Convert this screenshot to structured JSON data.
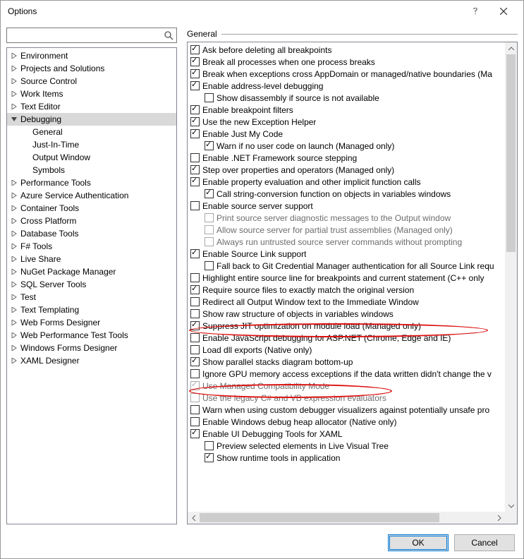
{
  "window": {
    "title": "Options"
  },
  "search": {
    "placeholder": ""
  },
  "section": {
    "label": "General"
  },
  "tree": [
    {
      "label": "Environment",
      "expandable": true
    },
    {
      "label": "Projects and Solutions",
      "expandable": true
    },
    {
      "label": "Source Control",
      "expandable": true
    },
    {
      "label": "Work Items",
      "expandable": true
    },
    {
      "label": "Text Editor",
      "expandable": true
    },
    {
      "label": "Debugging",
      "expandable": true,
      "expanded": true,
      "selected": true,
      "children": [
        {
          "label": "General"
        },
        {
          "label": "Just-In-Time"
        },
        {
          "label": "Output Window"
        },
        {
          "label": "Symbols"
        }
      ]
    },
    {
      "label": "Performance Tools",
      "expandable": true
    },
    {
      "label": "Azure Service Authentication",
      "expandable": true
    },
    {
      "label": "Container Tools",
      "expandable": true
    },
    {
      "label": "Cross Platform",
      "expandable": true
    },
    {
      "label": "Database Tools",
      "expandable": true
    },
    {
      "label": "F# Tools",
      "expandable": true
    },
    {
      "label": "Live Share",
      "expandable": true
    },
    {
      "label": "NuGet Package Manager",
      "expandable": true
    },
    {
      "label": "SQL Server Tools",
      "expandable": true
    },
    {
      "label": "Test",
      "expandable": true
    },
    {
      "label": "Text Templating",
      "expandable": true
    },
    {
      "label": "Web Forms Designer",
      "expandable": true
    },
    {
      "label": "Web Performance Test Tools",
      "expandable": true
    },
    {
      "label": "Windows Forms Designer",
      "expandable": true
    },
    {
      "label": "XAML Designer",
      "expandable": true
    }
  ],
  "options": [
    {
      "indent": 1,
      "checked": true,
      "label": "Ask before deleting all breakpoints"
    },
    {
      "indent": 1,
      "checked": true,
      "label": "Break all processes when one process breaks"
    },
    {
      "indent": 1,
      "checked": true,
      "label": "Break when exceptions cross AppDomain or managed/native boundaries (Ma"
    },
    {
      "indent": 1,
      "checked": true,
      "label": "Enable address-level debugging"
    },
    {
      "indent": 2,
      "checked": false,
      "label": "Show disassembly if source is not available"
    },
    {
      "indent": 1,
      "checked": true,
      "label": "Enable breakpoint filters"
    },
    {
      "indent": 1,
      "checked": true,
      "label": "Use the new Exception Helper"
    },
    {
      "indent": 1,
      "checked": true,
      "label": "Enable Just My Code"
    },
    {
      "indent": 2,
      "checked": true,
      "label": "Warn if no user code on launch (Managed only)"
    },
    {
      "indent": 1,
      "checked": false,
      "label": "Enable .NET Framework source stepping"
    },
    {
      "indent": 1,
      "checked": true,
      "label": "Step over properties and operators (Managed only)"
    },
    {
      "indent": 1,
      "checked": true,
      "label": "Enable property evaluation and other implicit function calls"
    },
    {
      "indent": 2,
      "checked": true,
      "label": "Call string-conversion function on objects in variables windows"
    },
    {
      "indent": 1,
      "checked": false,
      "label": "Enable source server support"
    },
    {
      "indent": 2,
      "checked": false,
      "disabled": true,
      "label": "Print source server diagnostic messages to the Output window"
    },
    {
      "indent": 2,
      "checked": false,
      "disabled": true,
      "label": "Allow source server for partial trust assemblies (Managed only)"
    },
    {
      "indent": 2,
      "checked": false,
      "disabled": true,
      "label": "Always run untrusted source server commands without prompting"
    },
    {
      "indent": 1,
      "checked": true,
      "label": "Enable Source Link support"
    },
    {
      "indent": 2,
      "checked": false,
      "label": "Fall back to Git Credential Manager authentication for all Source Link requ"
    },
    {
      "indent": 1,
      "checked": false,
      "label": "Highlight entire source line for breakpoints and current statement (C++ only"
    },
    {
      "indent": 1,
      "checked": true,
      "label": "Require source files to exactly match the original version"
    },
    {
      "indent": 1,
      "checked": false,
      "label": "Redirect all Output Window text to the Immediate Window"
    },
    {
      "indent": 1,
      "checked": false,
      "label": "Show raw structure of objects in variables windows"
    },
    {
      "indent": 1,
      "checked": true,
      "label": "Suppress JIT optimization on module load (Managed only)"
    },
    {
      "indent": 1,
      "checked": false,
      "label": "Enable JavaScript debugging for ASP.NET (Chrome, Edge and IE)"
    },
    {
      "indent": 1,
      "checked": false,
      "label": "Load dll exports (Native only)"
    },
    {
      "indent": 1,
      "checked": true,
      "label": "Show parallel stacks diagram bottom-up"
    },
    {
      "indent": 1,
      "checked": false,
      "label": "Ignore GPU memory access exceptions if the data written didn't change the v"
    },
    {
      "indent": 1,
      "checked": true,
      "disabled": true,
      "label": "Use Managed Compatibility Mode"
    },
    {
      "indent": 1,
      "checked": false,
      "disabled": true,
      "label": "Use the legacy C# and VB expression evaluators"
    },
    {
      "indent": 1,
      "checked": false,
      "label": "Warn when using custom debugger visualizers against potentially unsafe pro"
    },
    {
      "indent": 1,
      "checked": false,
      "label": "Enable Windows debug heap allocator (Native only)"
    },
    {
      "indent": 1,
      "checked": true,
      "label": "Enable UI Debugging Tools for XAML"
    },
    {
      "indent": 2,
      "checked": false,
      "label": "Preview selected elements in Live Visual Tree"
    },
    {
      "indent": 2,
      "checked": true,
      "label": "Show runtime tools in application"
    }
  ],
  "buttons": {
    "ok": "OK",
    "cancel": "Cancel"
  }
}
